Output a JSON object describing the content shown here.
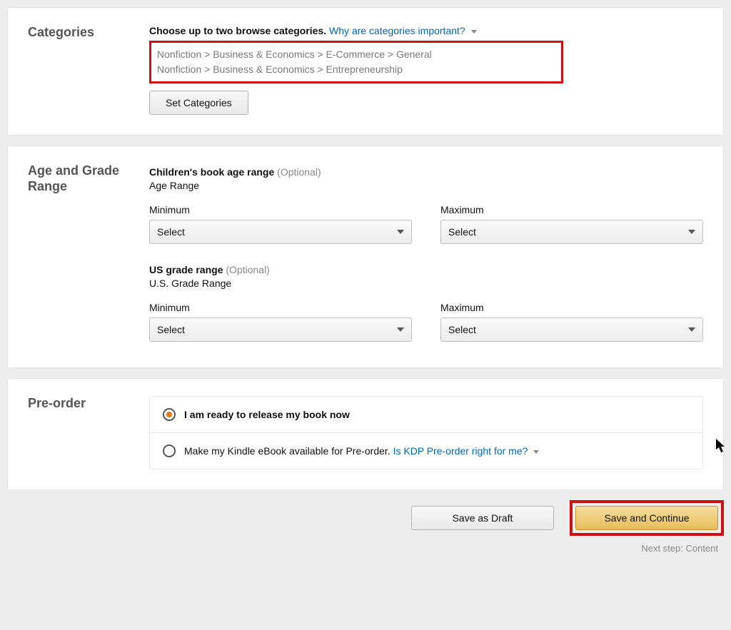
{
  "categories": {
    "title": "Categories",
    "instruct": "Choose up to two browse categories.",
    "link": "Why are categories important?",
    "path1": "Nonfiction > Business & Economics > E-Commerce > General",
    "path2": "Nonfiction > Business & Economics > Entrepreneurship",
    "button": "Set Categories"
  },
  "ageGrade": {
    "title": "Age and Grade Range",
    "age_heading": "Children's book age range",
    "optional": "(Optional)",
    "age_sub": "Age Range",
    "min_label": "Minimum",
    "max_label": "Maximum",
    "select_placeholder": "Select",
    "grade_heading": "US grade range",
    "grade_sub": "U.S. Grade Range"
  },
  "preorder": {
    "title": "Pre-order",
    "opt1": "I am ready to release my book now",
    "opt2": "Make my Kindle eBook available for Pre-order.",
    "opt2_link": "Is KDP Pre-order right for me?"
  },
  "footer": {
    "draft": "Save as Draft",
    "continue": "Save and Continue",
    "next": "Next step: Content"
  }
}
